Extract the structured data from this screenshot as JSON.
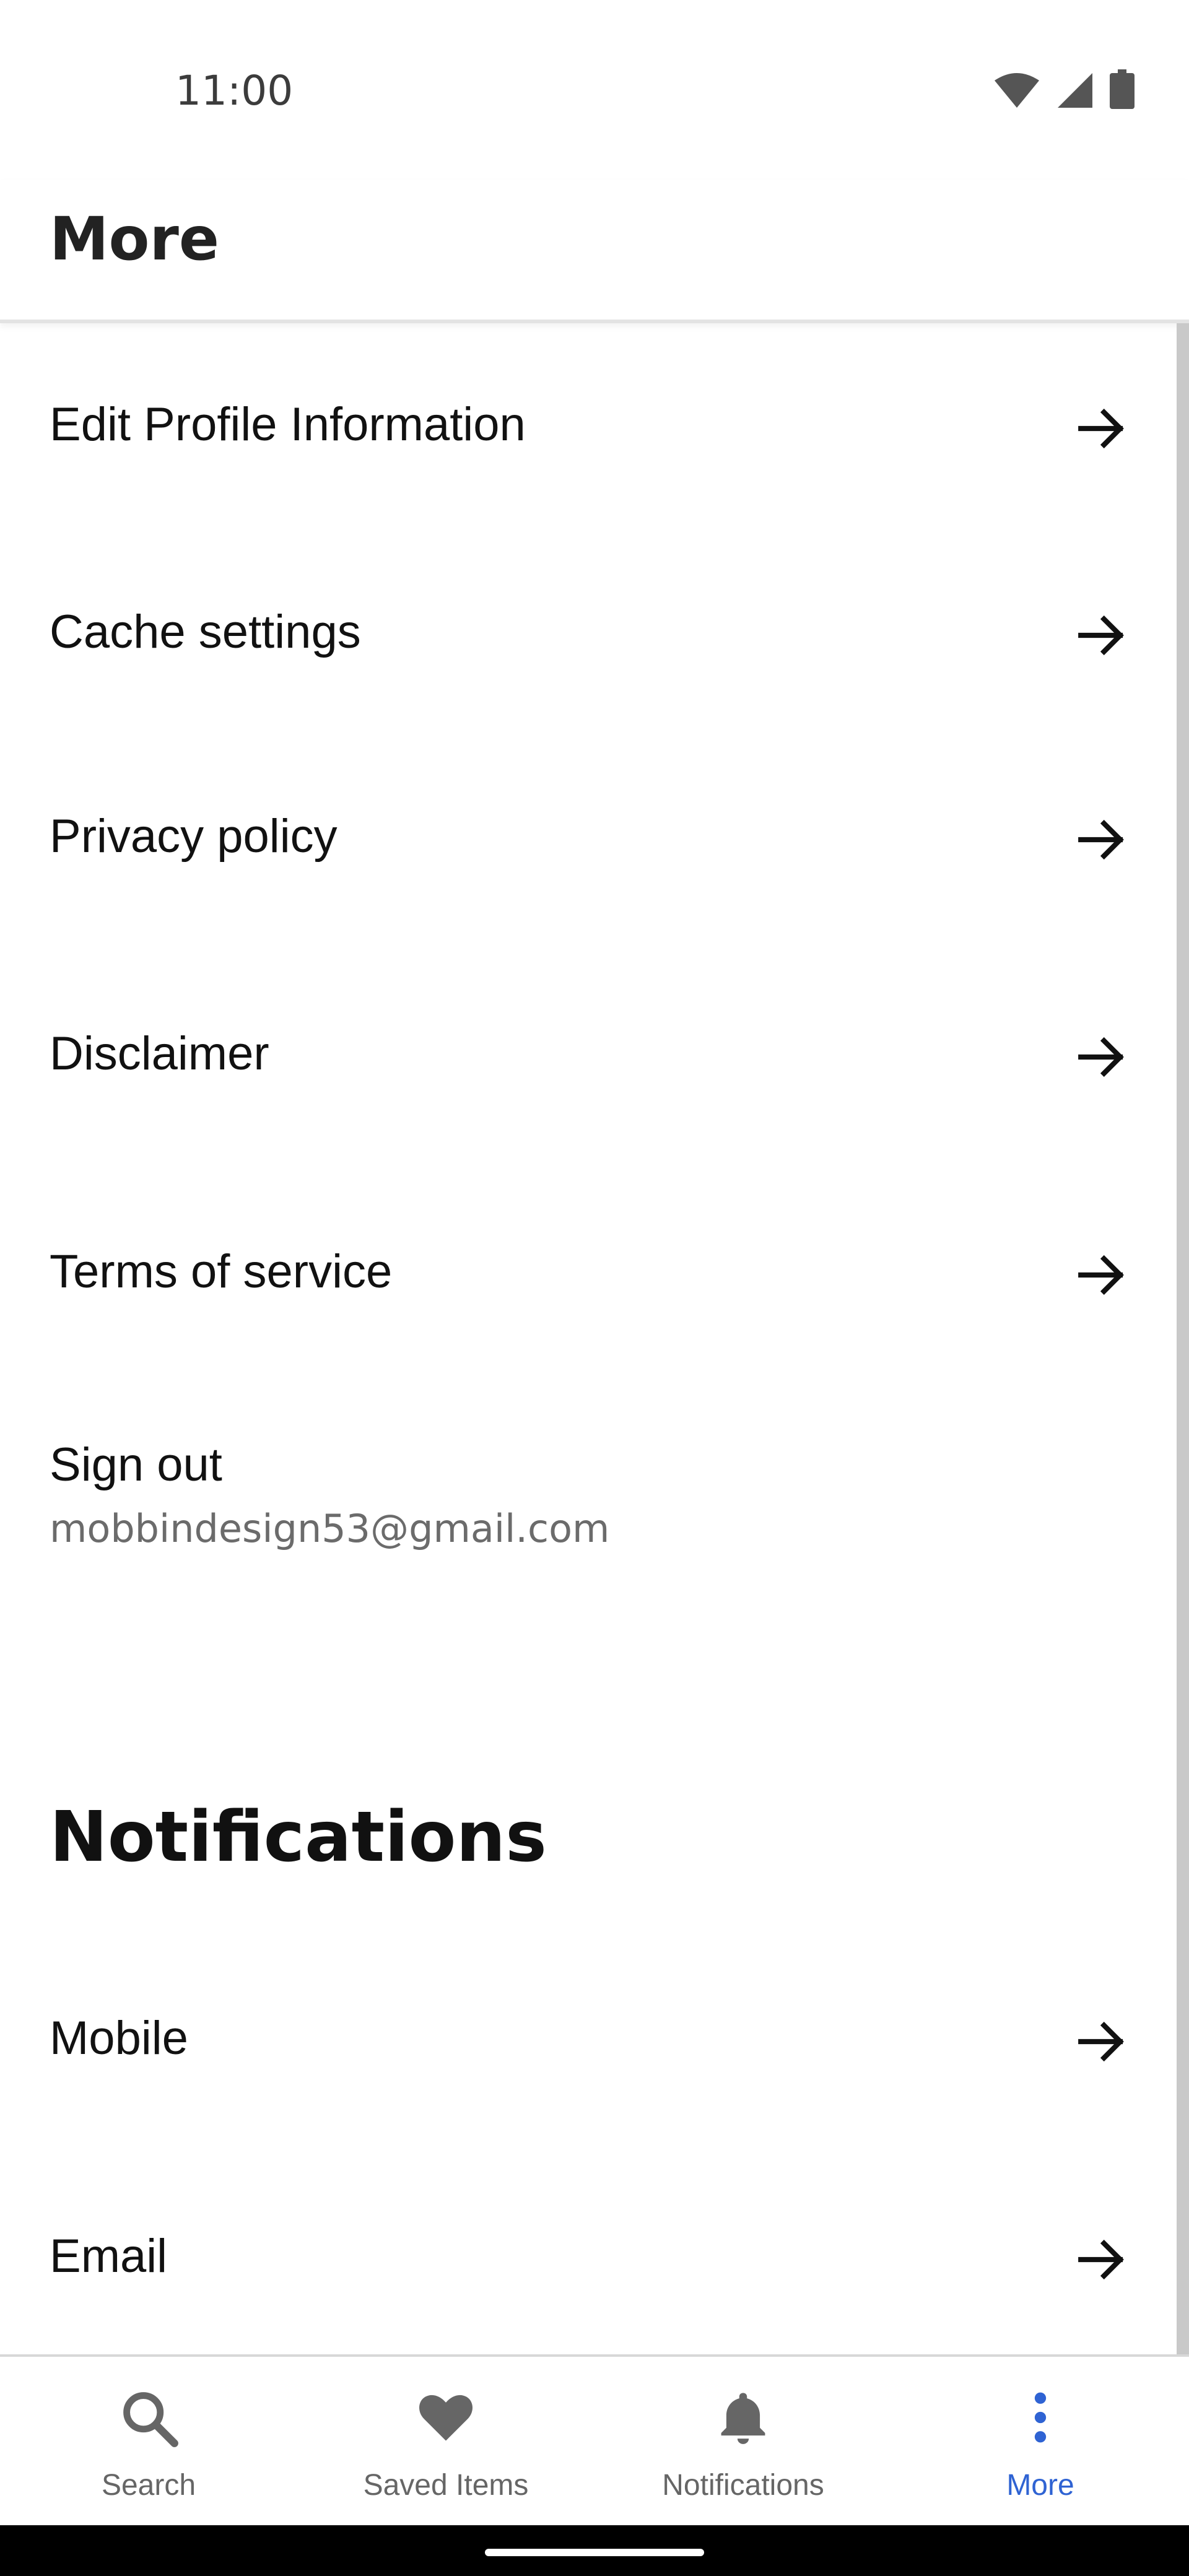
{
  "status_bar": {
    "time": "11:00",
    "icons": [
      "wifi-icon",
      "signal-icon",
      "battery-icon"
    ]
  },
  "app_bar": {
    "title": "More"
  },
  "menu_items": [
    {
      "label": "Edit Profile Information",
      "icon": "arrow-right-icon"
    },
    {
      "label": "Cache settings",
      "icon": "arrow-right-icon"
    },
    {
      "label": "Privacy policy",
      "icon": "arrow-right-icon"
    },
    {
      "label": "Disclaimer",
      "icon": "arrow-right-icon"
    },
    {
      "label": "Terms of service",
      "icon": "arrow-right-icon"
    }
  ],
  "sign_out": {
    "label": "Sign out",
    "email": "mobbindesign53@gmail.com"
  },
  "notifications_section": {
    "title": "Notifications",
    "items": [
      {
        "label": "Mobile",
        "icon": "arrow-right-icon"
      },
      {
        "label": "Email",
        "icon": "arrow-right-icon"
      }
    ]
  },
  "bottom_nav": {
    "items": [
      {
        "label": "Search",
        "icon": "search-icon",
        "active": false
      },
      {
        "label": "Saved Items",
        "icon": "heart-icon",
        "active": false
      },
      {
        "label": "Notifications",
        "icon": "bell-icon",
        "active": false
      },
      {
        "label": "More",
        "icon": "more-vertical-icon",
        "active": true
      }
    ]
  },
  "colors": {
    "accent": "#2f63d3",
    "text": "#111111",
    "secondary_text": "#6b6b6b",
    "nav_inactive": "#666666"
  }
}
